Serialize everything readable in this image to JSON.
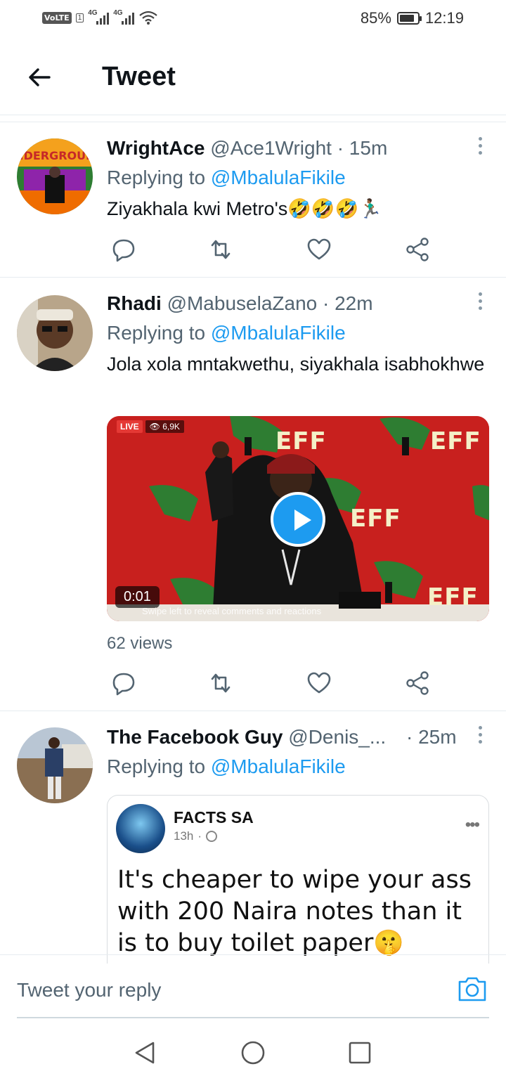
{
  "status_bar": {
    "network_badge": "VoLTE",
    "sim_slot": "1",
    "signal_1_label": "4G",
    "signal_2_label": "4G",
    "battery_percent": "85%",
    "battery_level": 0.85,
    "time": "12:19"
  },
  "header": {
    "title": "Tweet"
  },
  "tweets": [
    {
      "name": "WrightAce",
      "handle": "@Ace1Wright",
      "time": "· 15m",
      "replying_prefix": "Replying to ",
      "replying_to": "@MbalulaFikile",
      "text": "Ziyakhala kwi Metro's🤣🤣🤣🏃🏾‍♂️"
    },
    {
      "name": "Rhadi",
      "handle": "@MabuselaZano",
      "time": "· 22m",
      "replying_prefix": "Replying to ",
      "replying_to": "@MbalulaFikile",
      "text": "Jola xola mntakwethu, siyakhala isabhokhwe",
      "video": {
        "live_badge": "LIVE",
        "viewer_count": "👁 6,9K",
        "brand_text": "EFF",
        "duration": "0:01",
        "swipe_hint": "Swipe left to reveal comments and reactions"
      },
      "views": "62 views"
    },
    {
      "name": "The Facebook Guy",
      "handle": "@Denis_...",
      "time": "· 25m",
      "replying_prefix": "Replying to ",
      "replying_to": "@MbalulaFikile",
      "quoted": {
        "name": "FACTS SA",
        "time": "13h",
        "separator": "·",
        "text": "It's cheaper to wipe your ass with 200 Naira notes than it is to buy toilet paper🤫"
      }
    }
  ],
  "reply_bar": {
    "placeholder": "Tweet your reply"
  },
  "colors": {
    "link": "#1d9bf0",
    "secondary_text": "#536471",
    "divider": "#e6ecf0"
  },
  "icons": [
    "back-arrow-icon",
    "more-vertical-icon",
    "reply-icon",
    "retweet-icon",
    "like-icon",
    "share-icon",
    "play-icon",
    "camera-icon",
    "nav-back-icon",
    "nav-home-icon",
    "nav-recents-icon"
  ]
}
